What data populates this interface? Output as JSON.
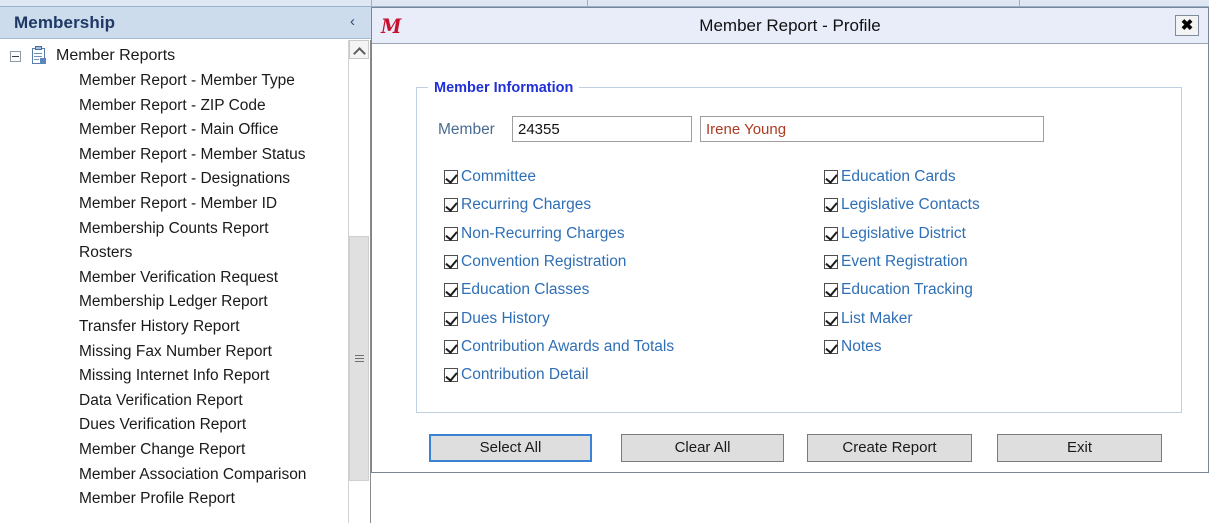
{
  "sidebar": {
    "title": "Membership",
    "collapse_icon": "chevron-left-icon",
    "tree_root": {
      "label": "Member Reports",
      "icon": "report-clipboard-icon",
      "expander": "collapse-minus-icon"
    },
    "items": [
      "Member Report - Member Type",
      "Member Report - ZIP Code",
      "Member Report - Main Office",
      "Member Report - Member Status",
      "Member Report - Designations",
      "Member Report - Member ID",
      "Membership Counts Report",
      "Rosters",
      "Member Verification Request",
      "Membership Ledger Report",
      "Transfer History Report",
      "Missing Fax Number Report",
      "Missing Internet Info Report",
      "Data Verification Report",
      "Dues Verification Report",
      "Member Change Report",
      "Member Association Comparison",
      "Member Profile Report"
    ],
    "scrollbar": {
      "up_arrow_icon": "chevron-up-icon",
      "thumb_grip_icon": "grip-lines-icon"
    }
  },
  "dialog": {
    "logo": "m-script-logo",
    "title": "Member Report - Profile",
    "close_label": "✖",
    "group": {
      "legend": "Member Information",
      "member_label": "Member",
      "member_id_value": "24355",
      "member_id_placeholder": "",
      "member_name_value": "Irene Young",
      "member_name_placeholder": ""
    },
    "checkboxes_left": [
      {
        "label": "Committee",
        "checked": true
      },
      {
        "label": "Recurring Charges",
        "checked": true
      },
      {
        "label": "Non-Recurring Charges",
        "checked": true
      },
      {
        "label": "Convention Registration",
        "checked": true
      },
      {
        "label": "Education Classes",
        "checked": true
      },
      {
        "label": "Dues History",
        "checked": true
      },
      {
        "label": "Contribution Awards and Totals",
        "checked": true
      },
      {
        "label": "Contribution Detail",
        "checked": true
      }
    ],
    "checkboxes_right": [
      {
        "label": "Education Cards",
        "checked": true
      },
      {
        "label": "Legislative Contacts",
        "checked": true
      },
      {
        "label": "Legislative District",
        "checked": true
      },
      {
        "label": "Event Registration",
        "checked": true
      },
      {
        "label": "Education Tracking",
        "checked": true
      },
      {
        "label": "List Maker",
        "checked": true
      },
      {
        "label": "Notes",
        "checked": true
      }
    ],
    "buttons": {
      "select_all": "Select All",
      "clear_all": "Clear All",
      "create_report": "Create Report",
      "exit": "Exit"
    }
  },
  "colors": {
    "sidebar_header_bg": "#ccdcec",
    "sidebar_title": "#1f3864",
    "dialog_titlebar_bg": "#e8edf9",
    "logo_red": "#c8102e",
    "legend_blue": "#2030d8",
    "checkbox_label_blue": "#2f6fb5",
    "member_name_red": "#b03a21",
    "button_bg": "#dedede",
    "focus_blue": "#3a82d2"
  }
}
